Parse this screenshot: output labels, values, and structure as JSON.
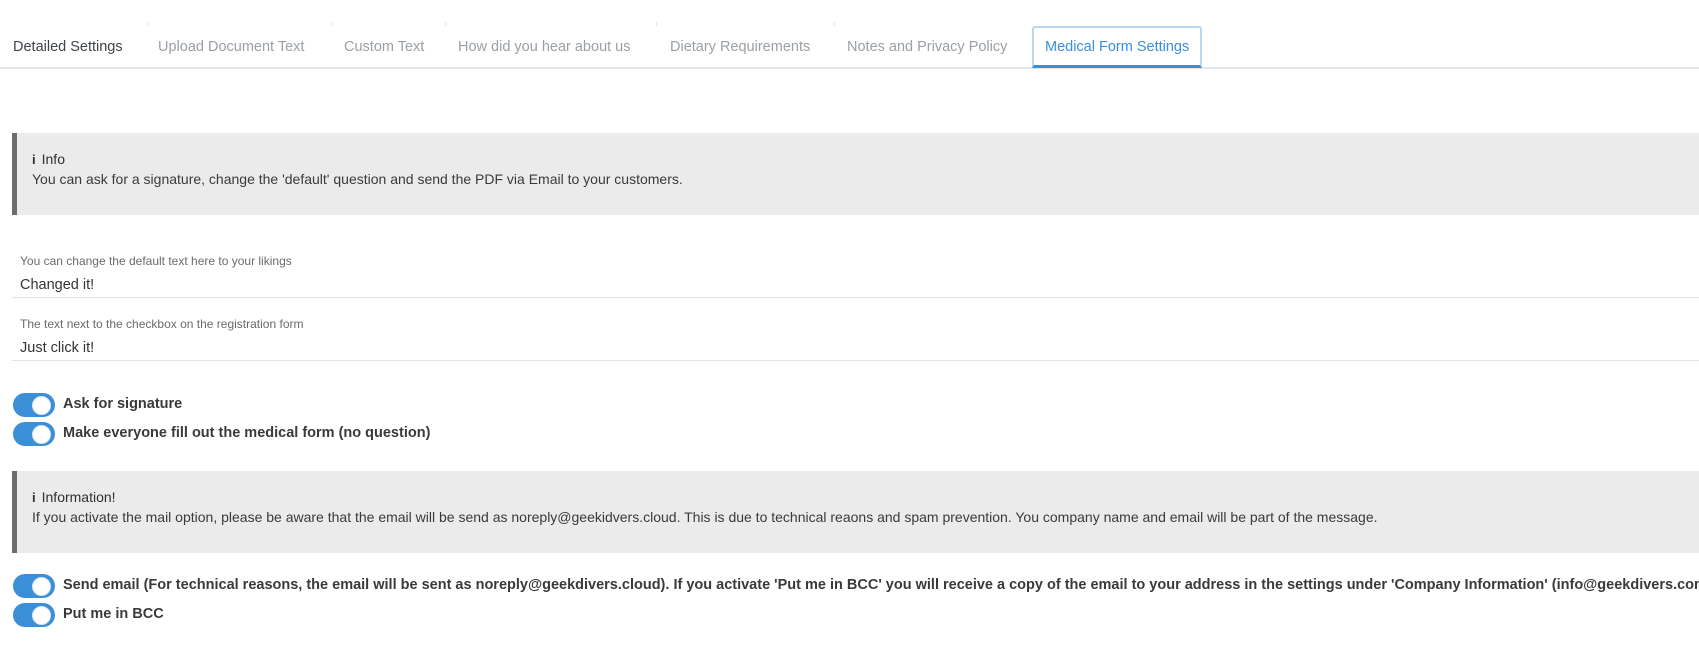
{
  "tabs": [
    {
      "label": "Detailed Settings",
      "active": false
    },
    {
      "label": "Upload Document Text",
      "active": false
    },
    {
      "label": "Custom Text",
      "active": false
    },
    {
      "label": "How did you hear about us",
      "active": false
    },
    {
      "label": "Dietary Requirements",
      "active": false
    },
    {
      "label": "Notes and Privacy Policy",
      "active": false
    },
    {
      "label": "Medical Form Settings",
      "active": true
    }
  ],
  "info_box": {
    "icon": "info-icon",
    "glyph": "i",
    "title": "Info",
    "text": "You can ask for a signature, change the 'default' question and send the PDF via Email to your customers."
  },
  "fields": {
    "default_text": {
      "label": "You can change the default text here to your likings",
      "value": "Changed it!"
    },
    "checkbox_text": {
      "label": "The text next to the checkbox on the registration form",
      "value": "Just click it!"
    }
  },
  "toggles": {
    "ask_signature": {
      "label": "Ask for signature",
      "on": true
    },
    "everyone_fill": {
      "label": "Make everyone fill out the medical form (no question)",
      "on": true
    },
    "send_email": {
      "label": "Send email (For technical reasons, the email will be sent as noreply@geekdivers.cloud). If you activate 'Put me in BCC' you will receive a copy of the email to your address in the settings under 'Company Information' (info@geekdivers.com)",
      "on": true
    },
    "bcc": {
      "label": "Put me in BCC",
      "on": true
    }
  },
  "information_box": {
    "icon": "info-icon",
    "glyph": "i",
    "title": "Information!",
    "text": "If you activate the mail option, please be aware that the email will be send as noreply@geekidvers.cloud. This is due to technical reaons and spam prevention. You company name and email will be part of the message."
  },
  "colors": {
    "accent": "#3a8fd8",
    "infobox_bg": "#ebebeb",
    "infobox_border": "#6d6d6d"
  }
}
